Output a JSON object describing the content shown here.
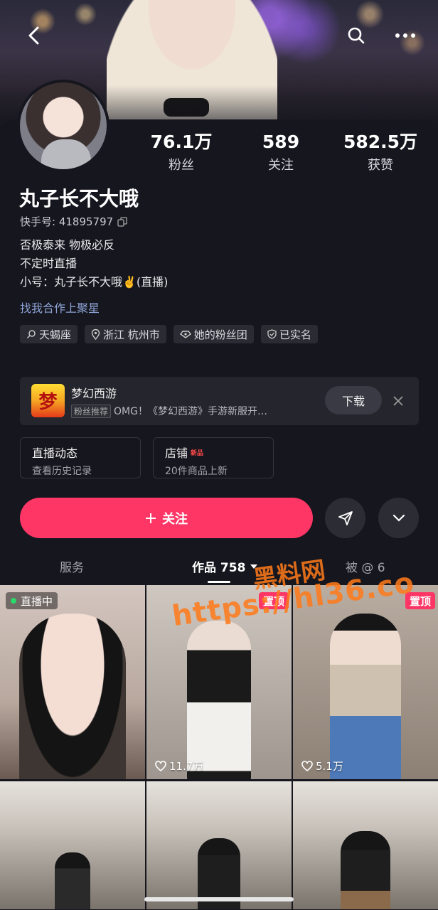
{
  "profile": {
    "name": "丸子长不大哦",
    "uid_label": "快手号: 41895797",
    "bio_line1": "否极泰来 物极必反",
    "bio_line2": "不定时直播",
    "bio_line3": "小号：丸子长不大哦✌️(直播)",
    "link_text": "找我合作上聚星"
  },
  "stats": [
    {
      "value": "76.1万",
      "label": "粉丝"
    },
    {
      "value": "589",
      "label": "关注"
    },
    {
      "value": "582.5万",
      "label": "获赞"
    }
  ],
  "tags": [
    "天蝎座",
    "浙江 杭州市",
    "她的粉丝团",
    "已实名"
  ],
  "ad": {
    "logo_char": "梦",
    "title": "梦幻西游",
    "chip": "粉丝推荐",
    "desc": "OMG！《梦幻西游》手游新服开…",
    "download_label": "下载"
  },
  "entries": [
    {
      "title": "直播动态",
      "sub": "查看历史记录"
    },
    {
      "title": "店铺",
      "badge": "新品",
      "sub": "20件商品上新"
    }
  ],
  "follow_label": "关注",
  "tabs": {
    "service": "服务",
    "works": "作品 758",
    "mentioned": "被 @ 6"
  },
  "grid": {
    "live_label": "直播中",
    "pin_label": "置顶",
    "likes": [
      "11.7万",
      "5.1万"
    ]
  },
  "watermark": {
    "brand": "黑料网",
    "url": "https://hl36.co"
  },
  "colors": {
    "accent": "#fe3666",
    "background": "#16161e",
    "link": "#8ea4d6"
  }
}
